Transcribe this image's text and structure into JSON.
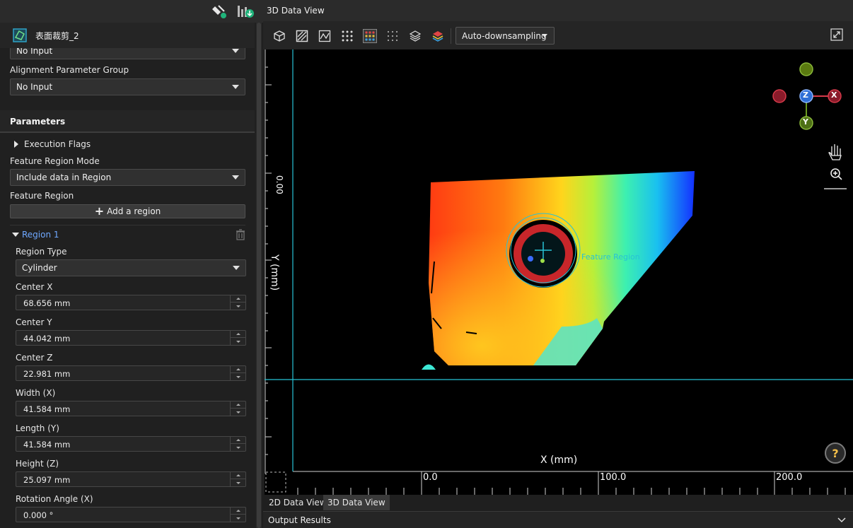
{
  "left_panel": {
    "step_title": "表面裁剪_2",
    "top_combo_value": "No Input",
    "alignment_label": "Alignment Parameter Group",
    "alignment_value": "No Input",
    "parameters_header": "Parameters",
    "execution_flags": "Execution Flags",
    "feature_region_mode_label": "Feature Region Mode",
    "feature_region_mode_value": "Include data in Region",
    "feature_region_label": "Feature Region",
    "add_region_label": "Add a region",
    "region_name": "Region 1",
    "region_type_label": "Region Type",
    "region_type_value": "Cylinder",
    "fields": [
      {
        "label": "Center X",
        "value": "68.656 mm"
      },
      {
        "label": "Center Y",
        "value": "44.042 mm"
      },
      {
        "label": "Center Z",
        "value": "22.981 mm"
      },
      {
        "label": "Width (X)",
        "value": "41.584 mm"
      },
      {
        "label": "Length (Y)",
        "value": "41.584 mm"
      },
      {
        "label": "Height (Z)",
        "value": "25.097 mm"
      },
      {
        "label": "Rotation Angle (X)",
        "value": "0.000 °"
      }
    ]
  },
  "right_panel": {
    "title": "3D Data View",
    "downsampling": "Auto-downsampling",
    "viewport": {
      "feature_region_label": "Feature Region",
      "y_axis_label": "Y (mm)",
      "x_axis_label": "X (mm)",
      "y_tick_label": "0.00",
      "x_ticks": [
        "0.0",
        "100.0",
        "200.0"
      ],
      "gizmo": {
        "z": "Z",
        "x": "X",
        "y": "Y"
      },
      "help": "?"
    },
    "tabs": [
      "2D Data View",
      "3D Data View"
    ],
    "active_tab": "3D Data View",
    "output_results": "Output Results"
  },
  "colors": {
    "accent_cyan": "#27c2d6",
    "region_link": "#6fa8ff",
    "gizmo_z": "#2f6fd6",
    "gizmo_x": "#d63a4a",
    "gizmo_y": "#6a9a1f",
    "help_glyph": "#f5c04a"
  }
}
